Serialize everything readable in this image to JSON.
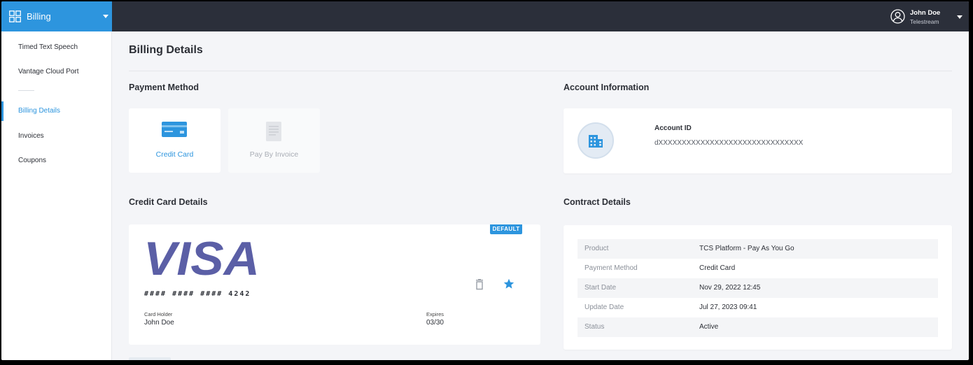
{
  "header": {
    "app_name": "Billing",
    "user": {
      "name": "John Doe",
      "org": "Telestream"
    }
  },
  "sidebar": {
    "items": [
      {
        "label": "Timed Text Speech"
      },
      {
        "label": "Vantage Cloud Port"
      },
      {
        "label": "Billing Details",
        "active": true
      },
      {
        "label": "Invoices"
      },
      {
        "label": "Coupons"
      }
    ]
  },
  "main": {
    "title": "Billing Details",
    "payment_method": {
      "title": "Payment Method",
      "options": [
        {
          "label": "Credit Card",
          "icon": "credit-card-icon",
          "selected": true
        },
        {
          "label": "Pay By Invoice",
          "icon": "invoice-icon",
          "selected": false
        }
      ]
    },
    "account_info": {
      "title": "Account Information",
      "label": "Account ID",
      "value": "dXXXXXXXXXXXXXXXXXXXXXXXXXXXXXXX"
    },
    "credit_card": {
      "title": "Credit Card Details",
      "badge": "DEFAULT",
      "brand": "VISA",
      "number": "#### #### #### 4242",
      "holder_label": "Card Holder",
      "holder": "John Doe",
      "expires_label": "Expires",
      "expires": "03/30"
    },
    "contract": {
      "title": "Contract Details",
      "rows": [
        {
          "key": "Product",
          "value": "TCS Platform - Pay As You Go"
        },
        {
          "key": "Payment Method",
          "value": "Credit Card"
        },
        {
          "key": "Start Date",
          "value": "Nov 29, 2022 12:45"
        },
        {
          "key": "Update Date",
          "value": "Jul 27, 2023 09:41"
        },
        {
          "key": "Status",
          "value": "Active"
        }
      ]
    }
  },
  "colors": {
    "accent": "#2d95de",
    "topbar": "#2b2f3a",
    "visa": "#5b5fa6"
  }
}
